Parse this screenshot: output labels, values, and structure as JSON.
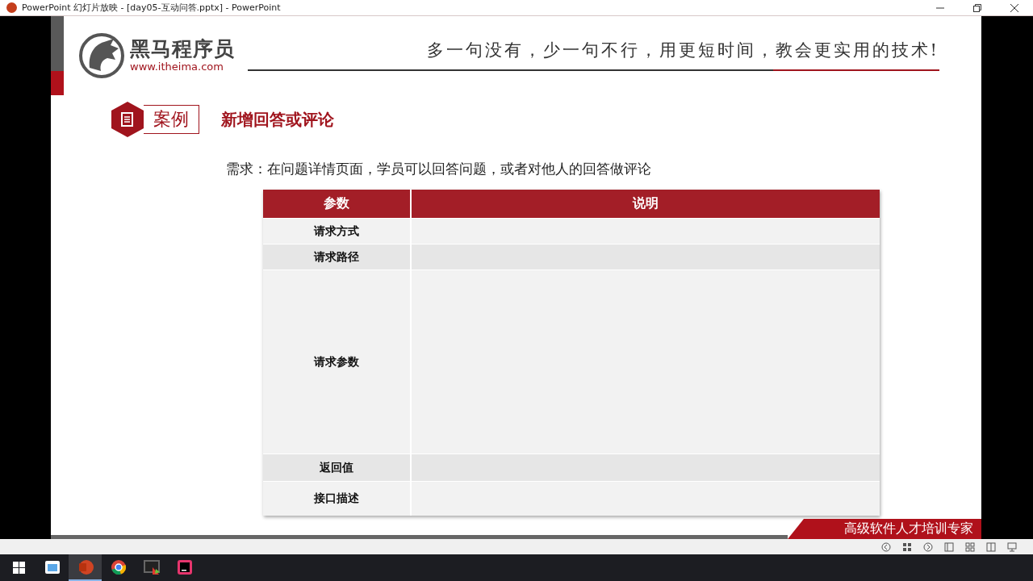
{
  "window": {
    "title": "PowerPoint 幻灯片放映 - [day05-互动问答.pptx] - PowerPoint"
  },
  "slide": {
    "logo": {
      "name": "黑马程序员",
      "url": "www.itheima.com"
    },
    "slogan": "多一句没有，少一句不行，用更短时间，教会更实用的技术!",
    "section": {
      "badge": "案例",
      "title": "新增回答或评论"
    },
    "requirement": "需求：在问题详情页面，学员可以回答问题，或者对他人的回答做评论",
    "table": {
      "columns": [
        "参数",
        "说明"
      ],
      "rows": [
        {
          "param": "请求方式"
        },
        {
          "param": "请求路径"
        },
        {
          "param": "请求参数"
        },
        {
          "param": "返回值"
        },
        {
          "param": "接口描述"
        }
      ]
    },
    "footer_banner": "高级软件人才培训专家"
  },
  "taskbar": {
    "apps": [
      {
        "kind": "files",
        "selected": false
      },
      {
        "kind": "powerpoint",
        "selected": true
      },
      {
        "kind": "chrome",
        "selected": false
      },
      {
        "kind": "snip",
        "selected": false
      },
      {
        "kind": "ide",
        "selected": false
      }
    ]
  }
}
